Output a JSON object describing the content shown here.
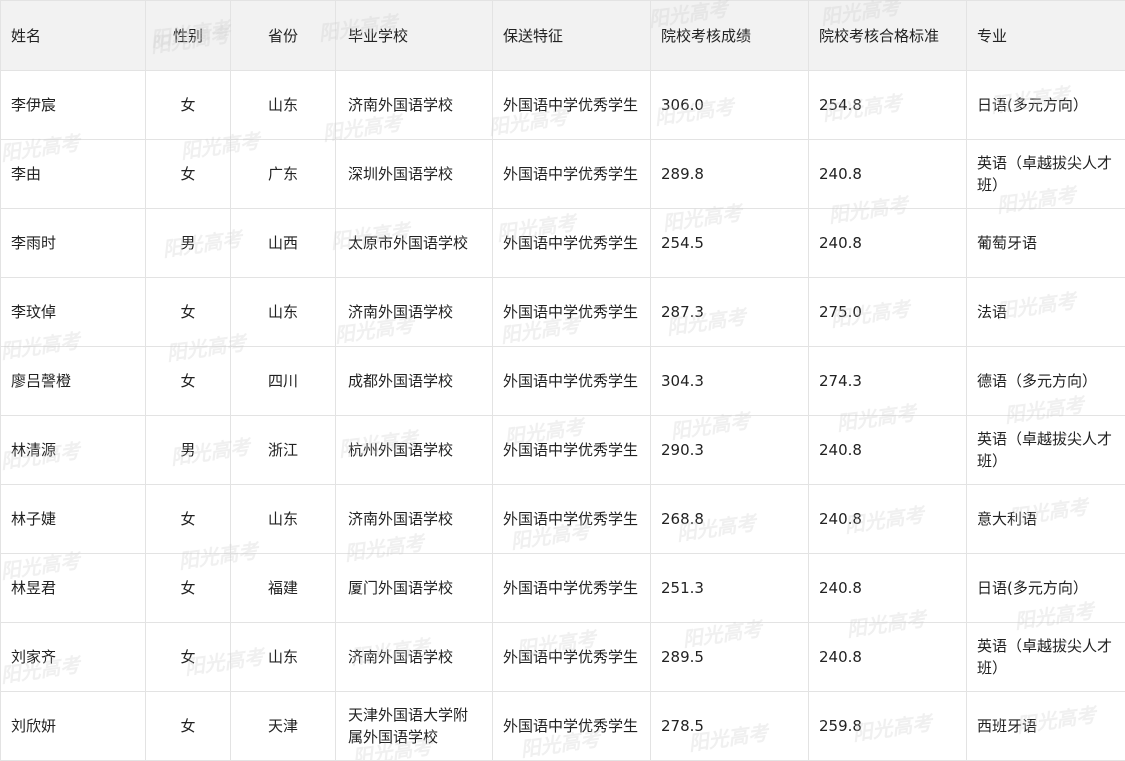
{
  "table": {
    "headers": {
      "name": "姓名",
      "gender": "性别",
      "province": "省份",
      "school": "毕业学校",
      "feature": "保送特征",
      "score": "院校考核成绩",
      "pass_line": "院校考核合格标准",
      "major": "专业"
    },
    "rows": [
      {
        "name": "李伊宸",
        "gender": "女",
        "province": "山东",
        "school": "济南外国语学校",
        "feature": "外国语中学优秀学生",
        "score": "306.0",
        "pass_line": "254.8",
        "major": "日语(多元方向）"
      },
      {
        "name": "李由",
        "gender": "女",
        "province": "广东",
        "school": "深圳外国语学校",
        "feature": "外国语中学优秀学生",
        "score": "289.8",
        "pass_line": "240.8",
        "major": "英语（卓越拔尖人才班）"
      },
      {
        "name": "李雨时",
        "gender": "男",
        "province": "山西",
        "school": "太原市外国语学校",
        "feature": "外国语中学优秀学生",
        "score": "254.5",
        "pass_line": "240.8",
        "major": "葡萄牙语"
      },
      {
        "name": "李玟倬",
        "gender": "女",
        "province": "山东",
        "school": "济南外国语学校",
        "feature": "外国语中学优秀学生",
        "score": "287.3",
        "pass_line": "275.0",
        "major": "法语"
      },
      {
        "name": "廖吕謦橙",
        "gender": "女",
        "province": "四川",
        "school": "成都外国语学校",
        "feature": "外国语中学优秀学生",
        "score": "304.3",
        "pass_line": "274.3",
        "major": "德语（多元方向）"
      },
      {
        "name": "林清源",
        "gender": "男",
        "province": "浙江",
        "school": "杭州外国语学校",
        "feature": "外国语中学优秀学生",
        "score": "290.3",
        "pass_line": "240.8",
        "major": "英语（卓越拔尖人才班）"
      },
      {
        "name": "林子婕",
        "gender": "女",
        "province": "山东",
        "school": "济南外国语学校",
        "feature": "外国语中学优秀学生",
        "score": "268.8",
        "pass_line": "240.8",
        "major": "意大利语"
      },
      {
        "name": "林昱君",
        "gender": "女",
        "province": "福建",
        "school": "厦门外国语学校",
        "feature": "外国语中学优秀学生",
        "score": "251.3",
        "pass_line": "240.8",
        "major": "日语(多元方向）"
      },
      {
        "name": "刘家齐",
        "gender": "女",
        "province": "山东",
        "school": "济南外国语学校",
        "feature": "外国语中学优秀学生",
        "score": "289.5",
        "pass_line": "240.8",
        "major": "英语（卓越拔尖人才班）"
      },
      {
        "name": "刘欣妍",
        "gender": "女",
        "province": "天津",
        "school": "天津外国语大学附属外国语学校",
        "feature": "外国语中学优秀学生",
        "score": "278.5",
        "pass_line": "259.8",
        "major": "西班牙语"
      }
    ]
  },
  "watermark": {
    "text": "阳光高考"
  }
}
